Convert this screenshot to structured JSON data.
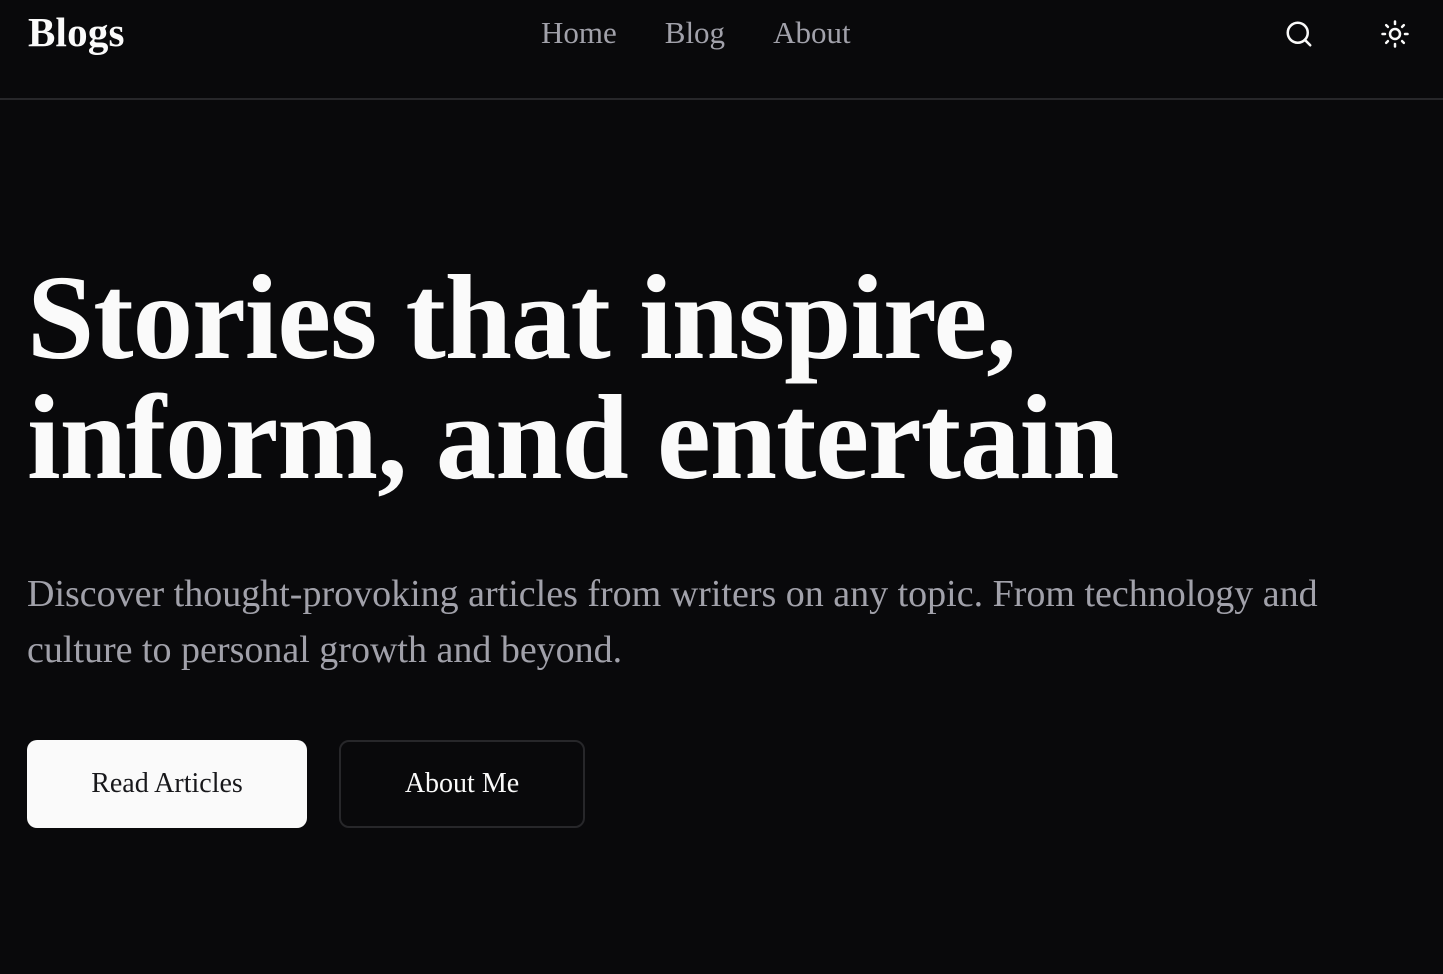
{
  "header": {
    "brand": "Blogs",
    "nav": [
      {
        "label": "Home"
      },
      {
        "label": "Blog"
      },
      {
        "label": "About"
      }
    ],
    "icons": {
      "search": "search-icon",
      "theme": "sun-icon"
    }
  },
  "hero": {
    "title_line1": "Stories that inspire,",
    "title_line2": "inform, and entertain",
    "subtitle": "Discover thought-provoking articles from writers on any topic. From technology and culture to personal growth and beyond.",
    "primary_button": "Read Articles",
    "secondary_button": "About Me"
  },
  "colors": {
    "background": "#09090b",
    "foreground": "#fafafa",
    "muted": "#a1a1aa",
    "border": "#27272a"
  }
}
